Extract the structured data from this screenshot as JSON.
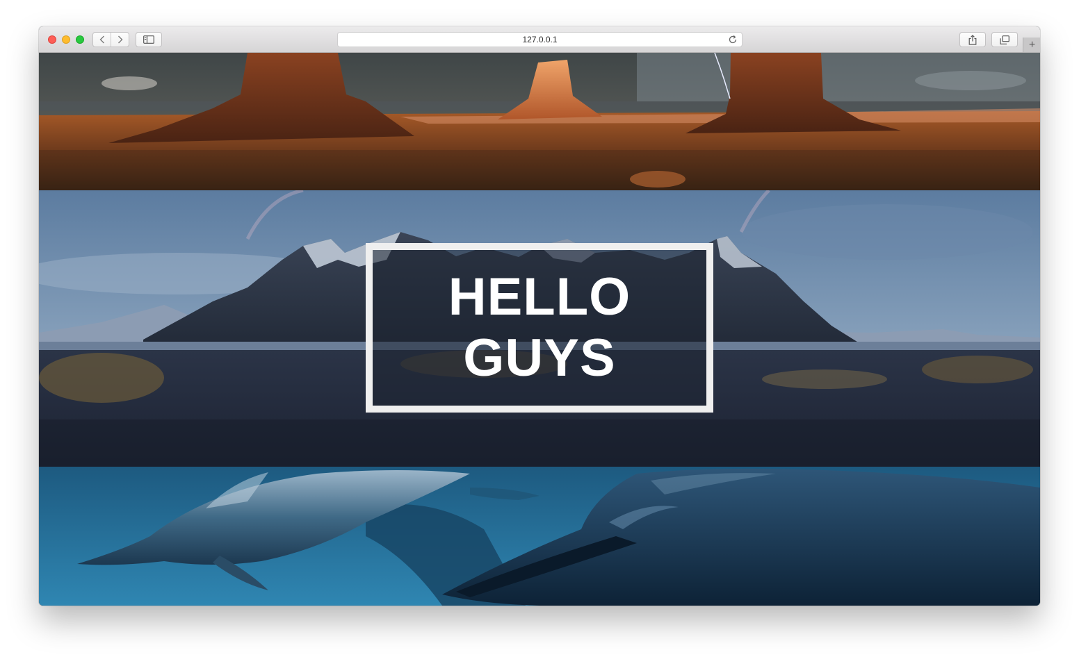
{
  "browser": {
    "url": "127.0.0.1",
    "back_icon": "chevron-left-icon",
    "forward_icon": "chevron-right-icon",
    "sidebar_icon": "sidebar-icon",
    "reload_icon": "reload-icon",
    "share_icon": "share-icon",
    "tabs_icon": "tabs-overview-icon",
    "new_tab_label": "+"
  },
  "hero": {
    "line1": "HELLO",
    "line2": "GUYS"
  },
  "sections": [
    {
      "image": "desert-buttes-photo"
    },
    {
      "image": "snowy-mountain-beach-photo"
    },
    {
      "image": "dolphins-underwater-photo"
    }
  ],
  "colors": {
    "frame_border": "#efefef",
    "hero_text": "#ffffff",
    "ocean": "#2a7fa8",
    "desert": "#8a4a22",
    "sky": "#5e7ea3"
  }
}
